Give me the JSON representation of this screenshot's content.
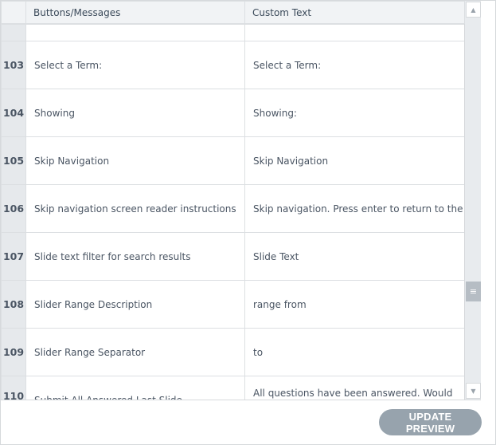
{
  "table": {
    "headers": {
      "index": "",
      "messages": "Buttons/Messages",
      "custom": "Custom Text"
    },
    "rows": [
      {
        "num": "103",
        "message": "Select a Term:",
        "custom": "Select a Term:"
      },
      {
        "num": "104",
        "message": "Showing",
        "custom": "Showing:"
      },
      {
        "num": "105",
        "message": "Skip Navigation",
        "custom": "Skip Navigation"
      },
      {
        "num": "106",
        "message": "Skip navigation screen reader instructions",
        "custom": "Skip navigation. Press enter to return to the slide."
      },
      {
        "num": "107",
        "message": "Slide text filter for search results",
        "custom": "Slide Text"
      },
      {
        "num": "108",
        "message": "Slider Range Description",
        "custom": "range from"
      },
      {
        "num": "109",
        "message": "Slider Range Separator",
        "custom": "to"
      },
      {
        "num": "110",
        "message": "Submit All Answered Last Slide",
        "custom": "All questions have been answered. Would you like"
      }
    ]
  },
  "scrollbar": {
    "up_icon": "triangle-up",
    "down_icon": "triangle-down",
    "thumb_icon": "grip-lines"
  },
  "footer": {
    "update_preview_label": "UPDATE PREVIEW"
  }
}
